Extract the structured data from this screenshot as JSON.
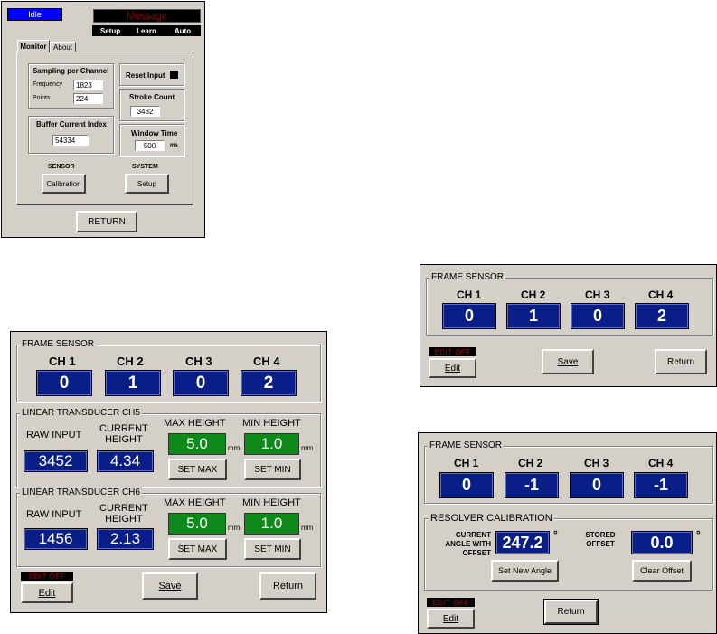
{
  "monitor_window": {
    "status": "Idle",
    "message": "Message",
    "top_buttons": [
      "Setup",
      "Learn",
      "Auto"
    ],
    "tabs": [
      "Monitor",
      "About"
    ],
    "sampling": {
      "title": "Sampling  per Channel",
      "frequency_label": "Frequency",
      "frequency_value": "1823",
      "points_label": "Points",
      "points_value": "224"
    },
    "reset_input_label": "Reset Input",
    "stroke_count": {
      "label": "Stroke Count",
      "value": "3432"
    },
    "buffer": {
      "label": "Buffer Current Index",
      "value": "54334"
    },
    "window_time": {
      "label": "Window Time",
      "value": "500",
      "unit": "ms"
    },
    "sensor_label": "SENSOR",
    "system_label": "SYSTEM",
    "calibration_button": "Calibration",
    "setup_button": "Setup",
    "return_button": "RETURN"
  },
  "frame_sensor_simple": {
    "title": "FRAME SENSOR",
    "channels": [
      {
        "name": "CH 1",
        "value": "0"
      },
      {
        "name": "CH 2",
        "value": "1"
      },
      {
        "name": "CH 3",
        "value": "0"
      },
      {
        "name": "CH 4",
        "value": "2"
      }
    ],
    "edit_status": "EDIT OFF",
    "edit_button": "Edit",
    "save_button": "Save",
    "return_button": "Return"
  },
  "transducer_window": {
    "frame_title": "FRAME SENSOR",
    "channels": [
      {
        "name": "CH 1",
        "value": "0"
      },
      {
        "name": "CH 2",
        "value": "1"
      },
      {
        "name": "CH 3",
        "value": "0"
      },
      {
        "name": "CH 4",
        "value": "2"
      }
    ],
    "transducers": [
      {
        "title": "LINEAR TRANSDUCER CH5",
        "raw_label": "RAW INPUT",
        "current_label_1": "CURRENT",
        "current_label_2": "HEIGHT",
        "max_label": "MAX HEIGHT",
        "min_label": "MIN HEIGHT",
        "raw_value": "3452",
        "current_value": "4.34",
        "max_value": "5.0",
        "min_value": "1.0",
        "unit": "mm",
        "set_max": "SET MAX",
        "set_min": "SET MIN"
      },
      {
        "title": "LINEAR TRANSDUCER CH6",
        "raw_label": "RAW INPUT",
        "current_label_1": "CURRENT",
        "current_label_2": "HEIGHT",
        "max_label": "MAX HEIGHT",
        "min_label": "MIN HEIGHT",
        "raw_value": "1456",
        "current_value": "2.13",
        "max_value": "5.0",
        "min_value": "1.0",
        "unit": "mm",
        "set_max": "SET MAX",
        "set_min": "SET MIN"
      }
    ],
    "edit_status": "EDIT OFF",
    "edit_button": "Edit",
    "save_button": "Save",
    "return_button": "Return"
  },
  "resolver_window": {
    "frame_title": "FRAME SENSOR",
    "channels": [
      {
        "name": "CH 1",
        "value": "0"
      },
      {
        "name": "CH 2",
        "value": "-1"
      },
      {
        "name": "CH 3",
        "value": "0"
      },
      {
        "name": "CH 4",
        "value": "-1"
      }
    ],
    "resolver_title": "RESOLVER CALIBRATION",
    "current_label_1": "CURRENT",
    "current_label_2": "ANGLE WITH",
    "current_label_3": "OFFSET",
    "current_value": "247.2",
    "stored_label_1": "STORED",
    "stored_label_2": "OFFSET",
    "stored_value": "0.0",
    "degree": "°",
    "set_new_angle": "Set New Angle",
    "clear_offset": "Clear Offset",
    "edit_status": "EDIT OFF",
    "edit_button": "Edit",
    "return_button": "Return"
  }
}
